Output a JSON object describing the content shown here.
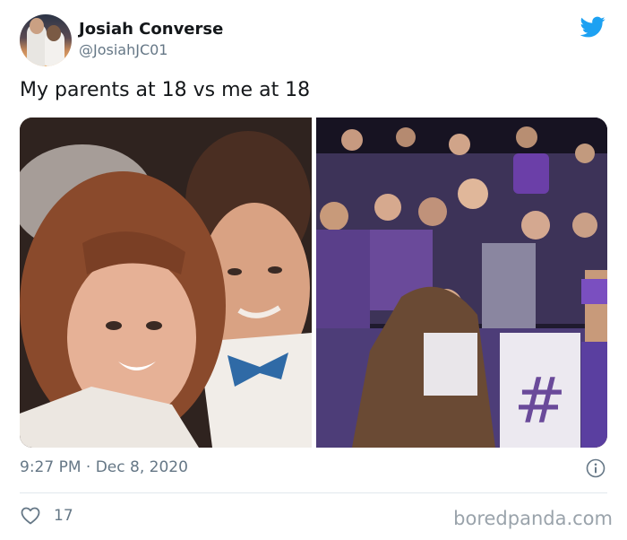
{
  "author": {
    "name": "Josiah Converse",
    "handle": "@JosiahJC01"
  },
  "tweet": {
    "text": "My parents at 18 vs me at 18"
  },
  "meta": {
    "timestamp": "9:27 PM · Dec 8, 2020"
  },
  "actions": {
    "like_count": "17"
  },
  "icons": {
    "brand": "twitter-bird-icon",
    "info": "info-icon",
    "like": "heart-icon"
  },
  "colors": {
    "brand": "#1da1f2",
    "text": "#14171a",
    "muted": "#657786",
    "divider": "#e1e8ed"
  },
  "watermark": "boredpanda.com"
}
